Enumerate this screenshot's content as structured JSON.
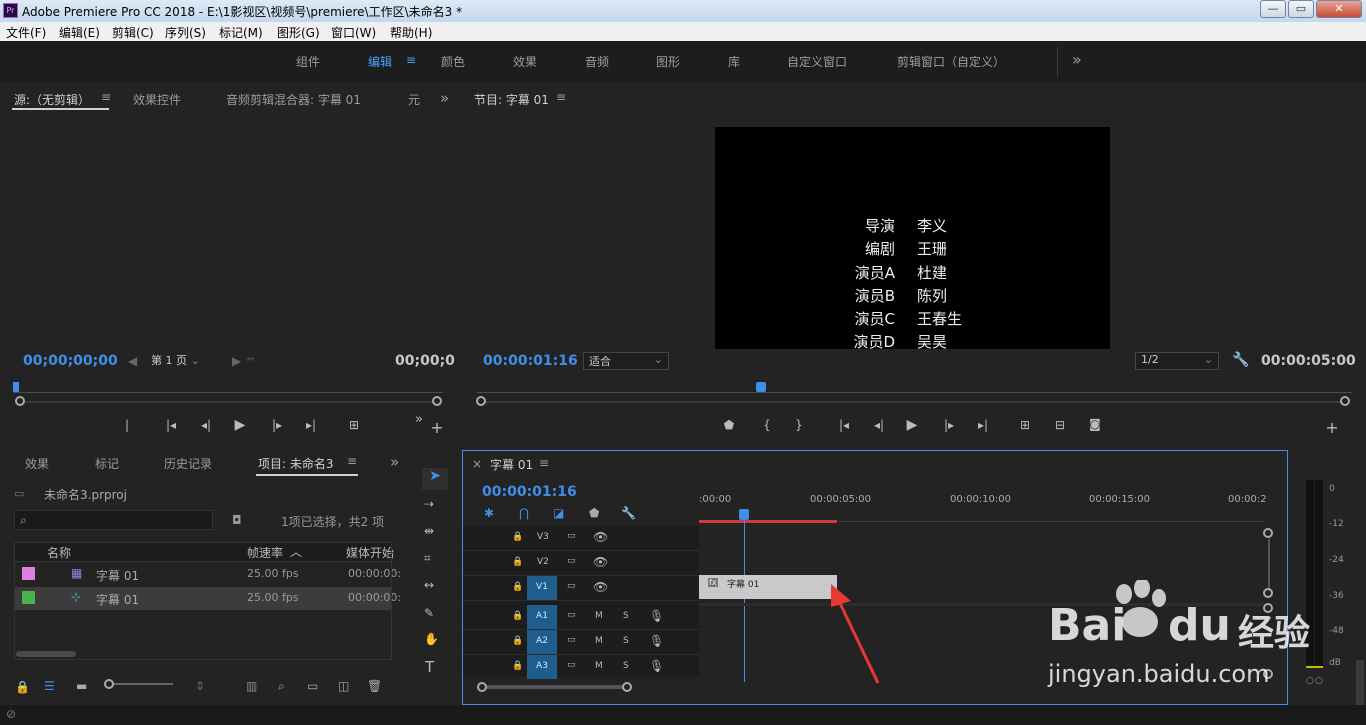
{
  "app": {
    "title": "Adobe Premiere Pro CC 2018 - E:\\1影视区\\视频号\\premiere\\工作区\\未命名3 *",
    "logo": "Pr"
  },
  "window": {
    "minimize": "—",
    "maximize": "▭",
    "close": "✕"
  },
  "menu": [
    "文件(F)",
    "编辑(E)",
    "剪辑(C)",
    "序列(S)",
    "标记(M)",
    "图形(G)",
    "窗口(W)",
    "帮助(H)"
  ],
  "workspaces": [
    "组件",
    "编辑",
    "颜色",
    "效果",
    "音频",
    "图形",
    "库",
    "自定义窗口",
    "剪辑窗口（自定义）"
  ],
  "workspace_more": "»",
  "source": {
    "tabs": [
      "源:（无剪辑）",
      "效果控件",
      "音频剪辑混合器: 字幕 01",
      "元"
    ],
    "more": "»",
    "timecode_left": "00;00;00;00",
    "page": "第 1 页",
    "timecode_right": "00;00;0"
  },
  "program": {
    "title": "节目: 字幕 01",
    "timecode": "00:00:01:16",
    "fit": "适合",
    "ratio": "1/2",
    "duration": "00:00:05:00",
    "credits": [
      {
        "role": "导演",
        "name": "李义"
      },
      {
        "role": "编剧",
        "name": "王珊"
      },
      {
        "role": "演员A",
        "name": "杜建"
      },
      {
        "role": "演员B",
        "name": "陈列"
      },
      {
        "role": "演员C",
        "name": "王春生"
      },
      {
        "role": "演员D",
        "name": "吴昊"
      }
    ]
  },
  "project": {
    "tabs": [
      "效果",
      "标记",
      "历史记录",
      "项目: 未命名3"
    ],
    "more": "»",
    "file": "未命名3.prproj",
    "selection": "1项已选择，共2 项",
    "columns": [
      "名称",
      "帧速率",
      "媒体开始"
    ],
    "items": [
      {
        "color": "#e07fe0",
        "name": "字幕 01",
        "fps": "25.00 fps",
        "start": "00:00:00:"
      },
      {
        "color": "#4caf50",
        "name": "字幕 01",
        "fps": "25.00 fps",
        "start": "00:00:00:"
      }
    ]
  },
  "timeline": {
    "close": "×",
    "title": "字幕 01",
    "timecode": "00:00:01:16",
    "ruler": [
      ":00:00",
      "00:00:05:00",
      "00:00:10:00",
      "00:00:15:00",
      "00:00:2"
    ],
    "tracks": [
      {
        "id": "V3",
        "target": false
      },
      {
        "id": "V2",
        "target": false
      },
      {
        "id": "V1",
        "target": true
      },
      {
        "id": "A1",
        "target": true
      },
      {
        "id": "A2",
        "target": true
      },
      {
        "id": "A3",
        "target": true
      }
    ],
    "audio_btns": {
      "m": "M",
      "s": "S"
    },
    "clip": {
      "label": "字幕 01",
      "icon": "fx"
    }
  },
  "meter": {
    "scale": [
      "0",
      "-12",
      "-24",
      "-36",
      "-48",
      "dB"
    ]
  },
  "watermark": {
    "brand": "Bai",
    "brand2": "du",
    "brand_cn": "经验",
    "url": "jingyan.baidu.com"
  }
}
